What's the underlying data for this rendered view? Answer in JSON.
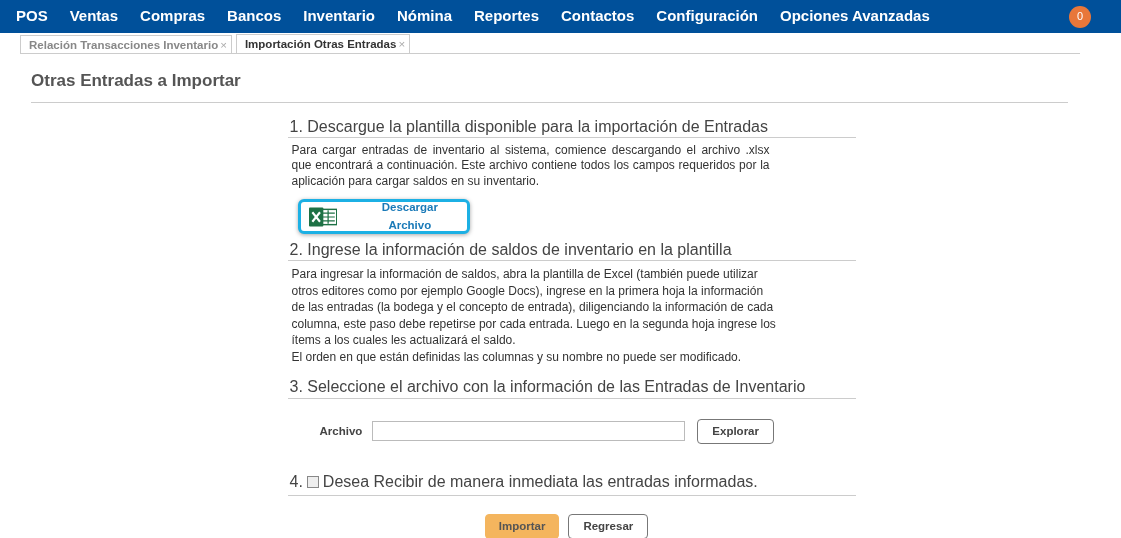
{
  "navbar": {
    "items": [
      "POS",
      "Ventas",
      "Compras",
      "Bancos",
      "Inventario",
      "Nómina",
      "Reportes",
      "Contactos",
      "Configuración",
      "Opciones Avanzadas"
    ],
    "notifications": "0"
  },
  "tabs": [
    {
      "label": "Relación Transacciones Inventario",
      "close": "×",
      "selected": false
    },
    {
      "label": "Importación Otras Entradas",
      "close": "×",
      "selected": true
    }
  ],
  "page_title": "Otras Entradas a Importar",
  "step1": {
    "heading": "1. Descargue la plantilla disponible para la importación de Entradas",
    "text": "Para cargar entradas de inventario al sistema, comience descargando el archivo .xlsx que encontrará a continuación. Este archivo contiene todos los campos requeridos por la aplicación para cargar saldos en su inventario.",
    "download_button": "Descargar Archivo"
  },
  "step2": {
    "heading": "2. Ingrese la información de saldos de inventario en la plantilla",
    "lines": [
      "Para ingresar la información de saldos, abra la plantilla de Excel (también puede utilizar",
      "otros editores como por ejemplo Google Docs), ingrese en la primera hoja la información",
      "de las entradas (la bodega y el concepto de entrada), diligenciando la información de cada",
      "columna, este paso debe repetirse por cada entrada. Luego en la segunda hoja ingrese los",
      "ítems a los cuales les actualizará el saldo.",
      "El orden en que están definidas las columnas y su nombre no puede ser modificado."
    ]
  },
  "step3": {
    "heading": "3. Seleccione el archivo con la información de las Entradas de Inventario",
    "file_label": "Archivo",
    "browse_button": "Explorar"
  },
  "step4": {
    "number": "4.",
    "label": "Desea Recibir de manera inmediata las entradas informadas.",
    "checked": false
  },
  "buttons": [
    {
      "label": "Importar",
      "kind": "primary"
    },
    {
      "label": "Regresar",
      "kind": "secondary"
    }
  ]
}
